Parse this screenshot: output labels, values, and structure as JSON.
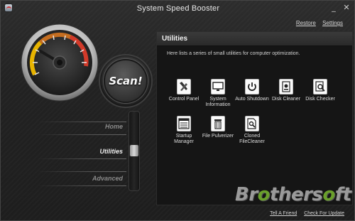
{
  "window": {
    "title": "System Speed Booster",
    "minimize_label": "_",
    "close_label": "✕"
  },
  "top_links": {
    "restore": "Restore",
    "settings": "Settings"
  },
  "scan": {
    "label": "Scan!"
  },
  "nav": {
    "items": [
      {
        "label": "Home",
        "active": false
      },
      {
        "label": "Utilities",
        "active": true
      },
      {
        "label": "Advanced",
        "active": false
      }
    ]
  },
  "panel": {
    "title": "Utilities",
    "description": "Here lists a series of small utilities for computer optimization.",
    "tools": [
      {
        "label": "Control Panel",
        "icon": "tools-icon"
      },
      {
        "label": "System Information",
        "icon": "monitor-icon"
      },
      {
        "label": "Auto Shutdown",
        "icon": "power-icon"
      },
      {
        "label": "Disk Cleaner",
        "icon": "disk-icon"
      },
      {
        "label": "Disk Checker",
        "icon": "disk-search-icon"
      },
      {
        "label": "Startup Manager",
        "icon": "list-window-icon"
      },
      {
        "label": "File Pulverizer",
        "icon": "trash-icon"
      },
      {
        "label": "Cloned FileCleaner",
        "icon": "file-search-icon"
      }
    ]
  },
  "watermark": "Brothersoft",
  "footer": {
    "tell_friend": "Tell A Friend",
    "check_update": "Check For Update"
  },
  "colors": {
    "accent_green": "#6aa02b",
    "gauge_red": "#d23a2a",
    "gauge_yellow": "#e8b400"
  }
}
